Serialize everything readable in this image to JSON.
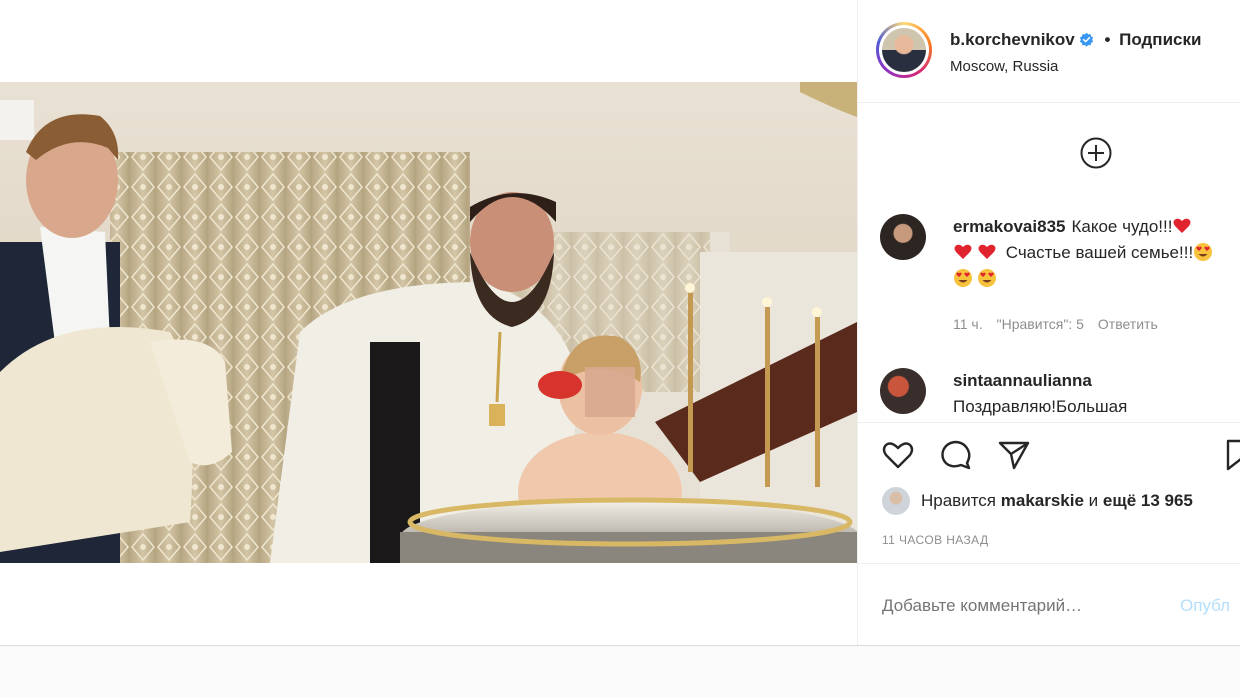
{
  "post": {
    "username": "b.korchevnikov",
    "follow_label": "Подписки",
    "follow_separator": "•",
    "location": "Moscow, Russia"
  },
  "comments": [
    {
      "username": "ermakovai835",
      "text_part1": "Какое чудо!!!",
      "text_part2": "Счастье вашей семье!!!",
      "time": "11 ч.",
      "likes": "\"Нравится\": 5",
      "reply": "Ответить"
    },
    {
      "username": "sintaannaulianna",
      "text": "Поздравляю!Большая"
    }
  ],
  "likes": {
    "prefix": "Нравится",
    "user": "makarskie",
    "middle": "и",
    "rest": "ещё 13 965"
  },
  "timeago": "11 часов назад",
  "add_comment": {
    "placeholder": "Добавьте комментарий…",
    "publish_label": "Опубл"
  },
  "colors": {
    "verified": "#3897f0",
    "heart": "#ed4956",
    "publish_disabled": "#b2dffc"
  }
}
